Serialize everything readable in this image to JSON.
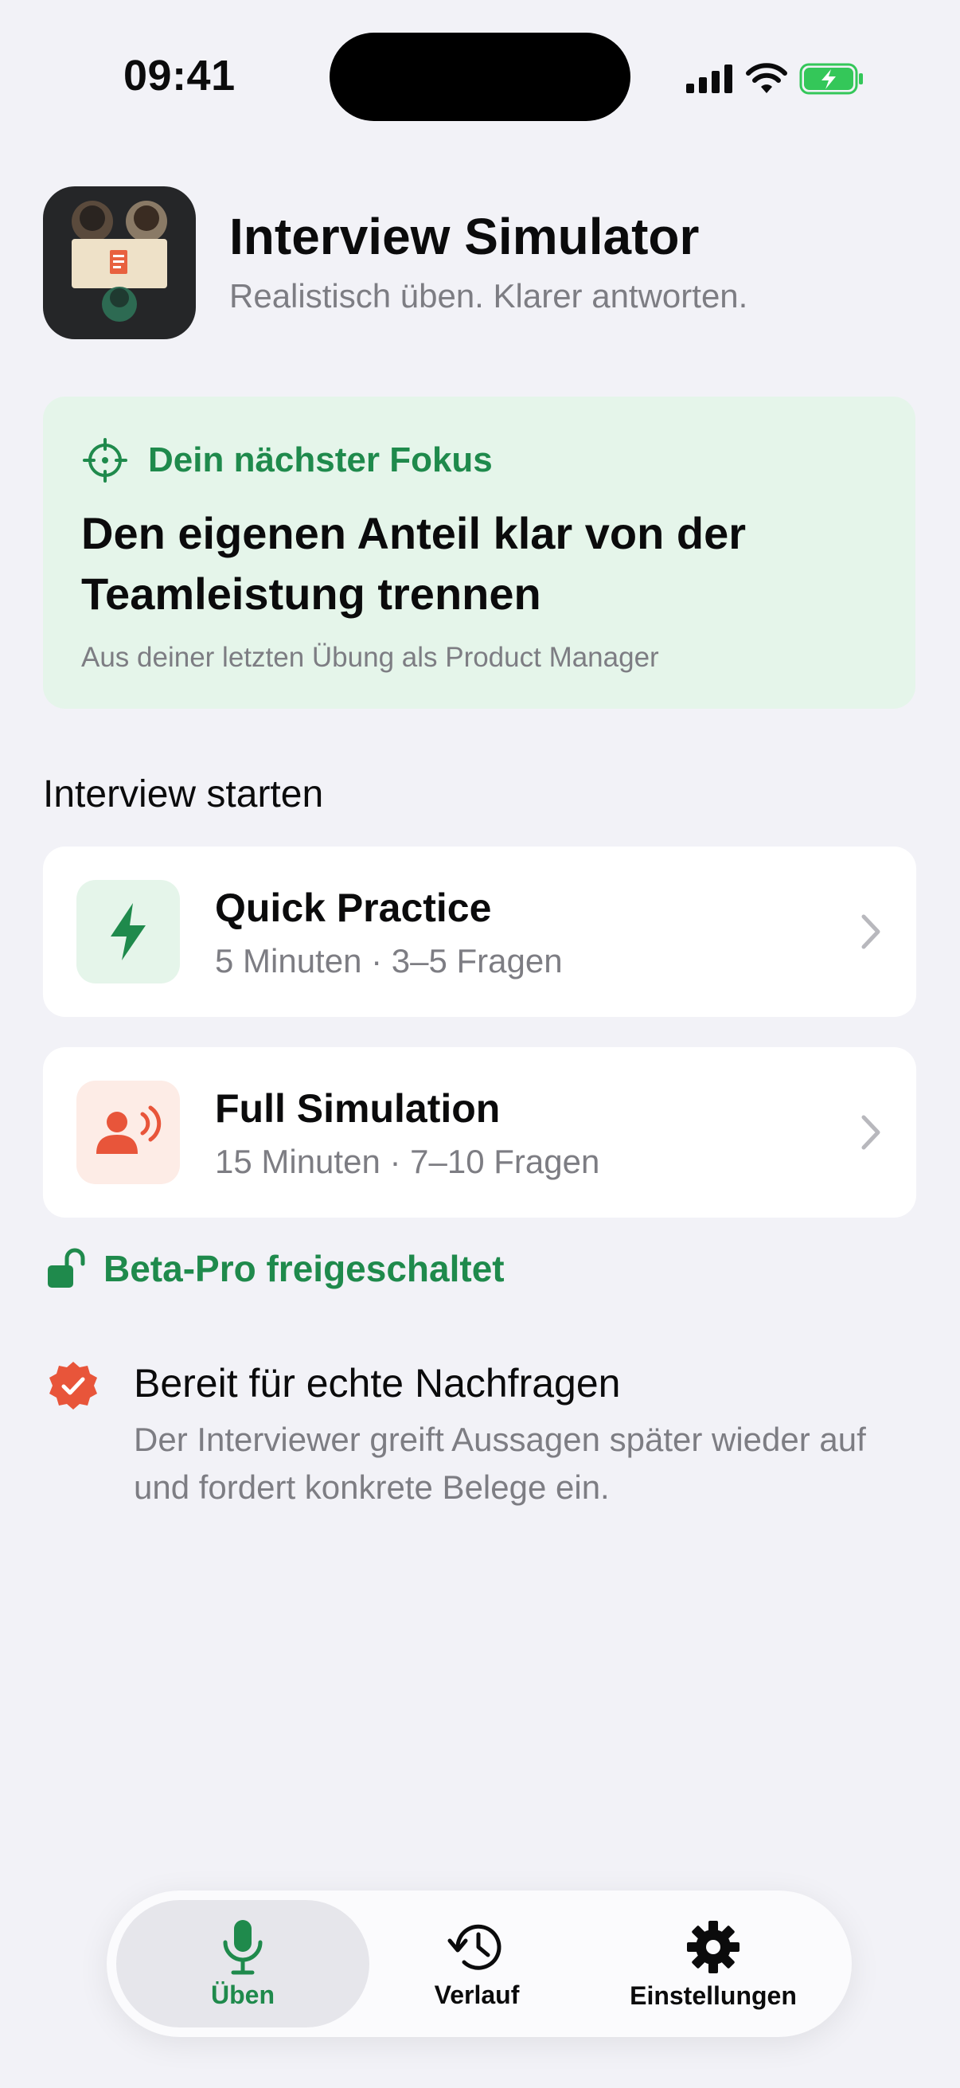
{
  "status": {
    "time": "09:41"
  },
  "header": {
    "title": "Interview Simulator",
    "subtitle": "Realistisch üben. Klarer antworten."
  },
  "focus": {
    "eyebrow": "Dein nächster Fokus",
    "title": "Den eigenen Anteil klar von der Teamleistung trennen",
    "note": "Aus deiner letzten Übung als Product Manager"
  },
  "section": {
    "title": "Interview starten"
  },
  "options": [
    {
      "title": "Quick Practice",
      "subtitle": "5 Minuten · 3–5 Fragen",
      "icon": "bolt-icon",
      "accent": "#1f8a4c",
      "tile": "#e5f5ea"
    },
    {
      "title": "Full Simulation",
      "subtitle": "15 Minuten · 7–10 Fragen",
      "icon": "speaking-person-icon",
      "accent": "#e8553a",
      "tile": "#fdece6"
    }
  ],
  "beta": {
    "label": "Beta-Pro freigeschaltet"
  },
  "ready": {
    "title": "Bereit für echte Nachfragen",
    "text": "Der Interviewer greift Aussagen später wieder auf und fordert konkrete Belege ein."
  },
  "tabs": [
    {
      "label": "Üben",
      "icon": "microphone-icon",
      "active": true
    },
    {
      "label": "Verlauf",
      "icon": "history-icon",
      "active": false
    },
    {
      "label": "Einstellungen",
      "icon": "gear-icon",
      "active": false
    }
  ],
  "colors": {
    "green": "#1f8a4c",
    "orange": "#e8553a",
    "background": "#f2f2f7"
  }
}
